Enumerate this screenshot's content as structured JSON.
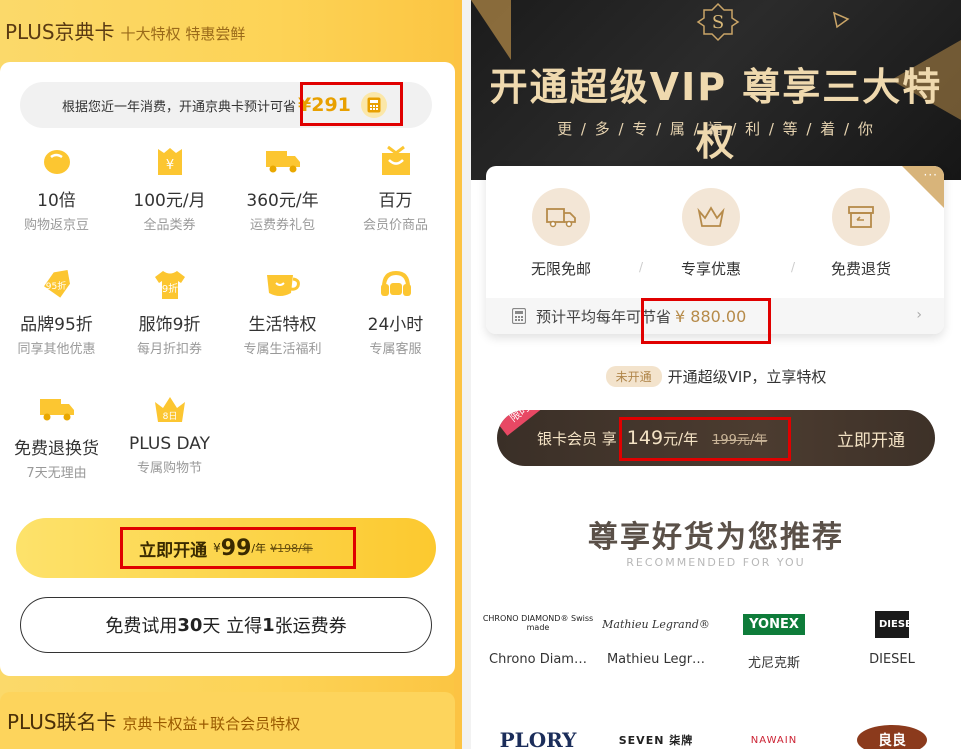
{
  "plus": {
    "title": "PLUS京典卡",
    "subtitle": "十大特权 特惠尝鲜",
    "estimate_text": "根据您近一年消费，开通京典卡预计可省",
    "estimate_amount": "¥291",
    "benefits": [
      {
        "icon": "bean-icon",
        "title": "10倍",
        "desc": "购物返京豆"
      },
      {
        "icon": "coupon-yen-icon",
        "title": "100元/月",
        "desc": "全品类券"
      },
      {
        "icon": "truck-icon",
        "title": "360元/年",
        "desc": "运费券礼包"
      },
      {
        "icon": "gift-box-icon",
        "title": "百万",
        "desc": "会员价商品"
      },
      {
        "icon": "discount-tag-icon",
        "title": "品牌95折",
        "desc": "同享其他优惠",
        "badge": "95折"
      },
      {
        "icon": "shirt-icon",
        "title": "服饰9折",
        "desc": "每月折扣券",
        "badge": "9折"
      },
      {
        "icon": "cup-icon",
        "title": "生活特权",
        "desc": "专属生活福利"
      },
      {
        "icon": "headset-icon",
        "title": "24小时",
        "desc": "专属客服"
      },
      {
        "icon": "return-truck-icon",
        "title": "免费退换货",
        "desc": "7天无理由"
      },
      {
        "icon": "crown-8-icon",
        "title": "PLUS DAY",
        "desc": "专属购物节",
        "badge": "8日"
      }
    ],
    "open_button": {
      "label": "立即开通",
      "yen": "¥",
      "price": "99",
      "per": "/年",
      "original": "¥198/年"
    },
    "trial_button": {
      "pre": "免费试用",
      "days": "30",
      "mid": "天 立得",
      "count": "1",
      "post": "张运费券"
    },
    "co_brand_title": "PLUS联名卡",
    "co_brand_subtitle": "京典卡权益+联合会员特权"
  },
  "vip": {
    "badge_letter": "S",
    "title": "开通超级VIP 尊享三大特权",
    "subtitle": "更 / 多 / 专 / 属 / 福 / 利 / 等 / 着 / 你",
    "corner_dots": "···",
    "features": [
      {
        "icon": "truck-icon",
        "label": "无限免邮"
      },
      {
        "icon": "crown-icon",
        "label": "专享优惠"
      },
      {
        "icon": "return-box-icon",
        "label": "免费退货"
      }
    ],
    "feature_sep": "/",
    "save_label": "预计平均每年可节省",
    "save_amount": "¥ 880.00",
    "chevron": "›",
    "not_open_badge": "未开通",
    "not_open_text": "开通超级VIP，立享特权",
    "silver": {
      "ribbon": "限时特惠",
      "label": "银卡会员 享",
      "price": "149",
      "per": "元/年",
      "original": "199元/年",
      "open": "立即开通"
    },
    "rec_title": "尊享好货为您推荐",
    "rec_subtitle": "RECOMMENDED FOR YOU",
    "brands": [
      {
        "logo": "CHRONO DIAMOND® Swiss made",
        "name": "Chrono Diam…"
      },
      {
        "logo": "Mathieu Legrand®",
        "name": "Mathieu Legr…"
      },
      {
        "logo": "YONEX",
        "name": "尤尼克斯"
      },
      {
        "logo": "DIESEL",
        "name": "DIESEL"
      }
    ],
    "brands_row2": [
      {
        "logo": "PLORY"
      },
      {
        "logo": "SEVEN 柒牌"
      },
      {
        "logo": "NAWAIN"
      },
      {
        "logo": "良良"
      }
    ]
  },
  "colors": {
    "plus_yellow": "#fdd356",
    "highlight_red": "#e00000",
    "vip_gold": "#d8b47a",
    "vip_dark": "#3a2f27"
  }
}
